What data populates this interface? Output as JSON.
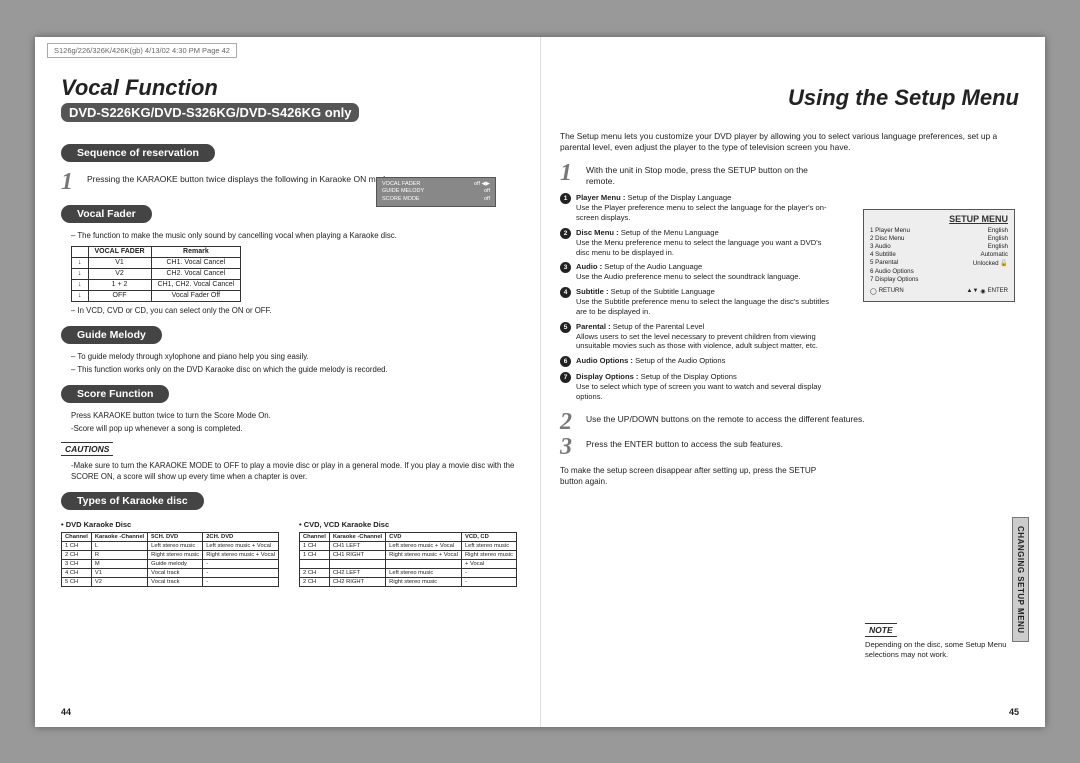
{
  "meta": {
    "tag": "S126g/226/326K/426K(gb)  4/13/02  4:30 PM  Page 42"
  },
  "left": {
    "title": "Vocal Function",
    "subtitle": "DVD-S226KG/DVD-S326KG/DVD-S426KG only",
    "sections": {
      "seq": "Sequence of reservation",
      "step1": "Pressing the KARAOKE button twice displays the following in Karaoke ON mode:",
      "vocalFader": "Vocal Fader",
      "vf_desc": "– The function to make the music only sound by cancelling vocal when playing a Karaoke disc.",
      "vf_table": {
        "head": [
          "",
          "VOCAL FADER",
          "Remark"
        ],
        "rows": [
          [
            "↓",
            "V1",
            "CH1. Vocal Cancel"
          ],
          [
            "↓",
            "V2",
            "CH2. Vocal Cancel"
          ],
          [
            "↓",
            "1 + 2",
            "CH1, CH2. Vocal Cancel"
          ],
          [
            "↓",
            "OFF",
            "Vocal Fader Off"
          ]
        ]
      },
      "vf_note": "– In VCD, CVD or CD, you can select only the ON or OFF.",
      "guide": "Guide Melody",
      "gm1": "– To guide melody through xylophone and piano help you sing easily.",
      "gm2": "– This function works only on the DVD Karaoke disc on which the guide melody is recorded.",
      "score": "Score Function",
      "sc1": "Press KARAOKE button twice to turn the Score Mode On.",
      "sc2": "-Score will pop up whenever a song is completed.",
      "cautions": "CAUTIONS",
      "caut_txt": "-Make sure to turn the KARAOKE MODE to OFF to play a movie disc or play in a general mode.  If you play a movie disc with the SCORE ON, a score will show up every time when a chapter is over.",
      "types": "Types of Karaoke disc",
      "dvdk": "DVD Karaoke Disc",
      "cvdk": "CVD, VCD Karaoke Disc"
    },
    "ktable_dvd": {
      "head": [
        "Channel",
        "Karaoke -Channel",
        "5CH. DVD",
        "2CH. DVD"
      ],
      "rows": [
        [
          "1 CH",
          "L",
          "Left stereo music",
          "Left stereo music + Vocal"
        ],
        [
          "2 CH",
          "R",
          "Right stereo music",
          "Right stereo music + Vocal"
        ],
        [
          "3 CH",
          "M",
          "Guide melody",
          "-"
        ],
        [
          "4 CH",
          "V1",
          "Vocal track",
          "-"
        ],
        [
          "5 CH",
          "V2",
          "Vocal track",
          "-"
        ]
      ]
    },
    "ktable_cvd": {
      "head": [
        "Channel",
        "Karaoke -Channel",
        "CVD",
        "VCD, CD"
      ],
      "rows": [
        [
          "1 CH",
          "CH1 LEFT",
          "Left stereo music + Vocal",
          "Left stereo music"
        ],
        [
          "1 CH",
          "CH1 RIGHT",
          "Right stereo music + Vocal",
          "Right stereo music"
        ],
        [
          "",
          "",
          "",
          "+ Vocal"
        ],
        [
          "2 CH",
          "CH2 LEFT",
          "Left stereo music",
          "-"
        ],
        [
          "2 CH",
          "CH2 RIGHT",
          "Right stereo music",
          "-"
        ]
      ]
    },
    "floatbox": {
      "r1": [
        "VOCAL FADER",
        "off ◀▶"
      ],
      "r2": [
        "GUIDE MELODY",
        "off"
      ],
      "r3": [
        "SCORE MODE",
        "off"
      ]
    },
    "page": "44"
  },
  "right": {
    "title": "Using the Setup Menu",
    "intro": "The Setup menu lets you customize your DVD player by allowing you to select various language preferences, set up a parental level, even adjust the player to the type of television screen you have.",
    "step1": "With the unit in Stop mode, press the SETUP button on the remote.",
    "items": [
      {
        "h": "Player Menu :",
        "t": " Setup of the Display Language",
        "d": "Use the Player preference menu to select the language for the player's on-screen displays."
      },
      {
        "h": "Disc Menu :",
        "t": " Setup of the Menu Language",
        "d": "Use the Menu preference menu to select the language you want a DVD's disc menu to be displayed in."
      },
      {
        "h": "Audio :",
        "t": " Setup of the Audio Language",
        "d": "Use the Audio preference menu to select the soundtrack language."
      },
      {
        "h": "Subtitle :",
        "t": " Setup of the Subtitle Language",
        "d": "Use the Subtitle preference menu to select the language the disc's subtitles are to be displayed in."
      },
      {
        "h": "Parental :",
        "t": " Setup of the Parental Level",
        "d": "Allows users to set the level necessary to prevent children from viewing unsuitable movies such as those with violence, adult subject matter, etc."
      },
      {
        "h": "Audio Options :",
        "t": " Setup of the Audio Options",
        "d": ""
      },
      {
        "h": "Display Options :",
        "t": " Setup of the Display Options",
        "d": "Use to select which type of screen you want to watch and several display options."
      }
    ],
    "step2": "Use the UP/DOWN buttons on the remote to access the different features.",
    "step3": "Press the ENTER button to access the sub features.",
    "closing": "To make the setup screen disappear after setting up, press the SETUP button again.",
    "setupbox": {
      "title": "SETUP MENU",
      "rows": [
        [
          "1  Player Menu",
          "English"
        ],
        [
          "2  Disc Menu",
          "English"
        ],
        [
          "3  Audio",
          "English"
        ],
        [
          "4  Subtitle",
          "Automatic"
        ],
        [
          "5  Parental",
          "Unlocked  🔓"
        ],
        [
          "6  Audio Options",
          ""
        ],
        [
          "7  Display Options",
          ""
        ]
      ],
      "return": "RETURN",
      "enter": "ENTER"
    },
    "note_h": "NOTE",
    "note": "Depending on the disc, some Setup Menu selections may not work.",
    "sidetab": "CHANGING\nSETUP MENU",
    "page": "45"
  }
}
